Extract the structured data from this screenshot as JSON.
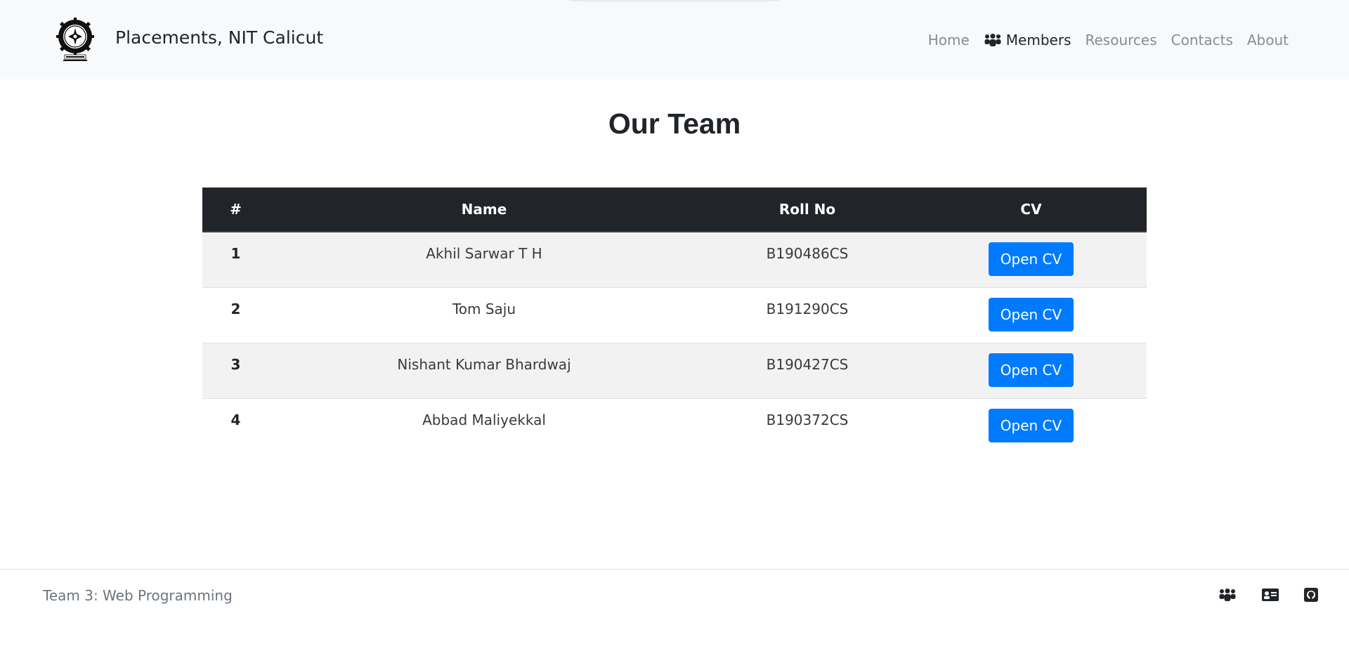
{
  "navbar": {
    "brand_name": "Placements, NIT Calicut",
    "logo_icon": "nitc-emblem-logo",
    "links": [
      {
        "label": "Home",
        "active": false
      },
      {
        "label": "Members",
        "active": true,
        "icon": "users-icon"
      },
      {
        "label": "Resources",
        "active": false
      },
      {
        "label": "Contacts",
        "active": false
      },
      {
        "label": "About",
        "active": false
      }
    ]
  },
  "main": {
    "title": "Our Team",
    "table": {
      "headers": [
        "#",
        "Name",
        "Roll No",
        "CV"
      ],
      "rows": [
        {
          "index": "1",
          "name": "Akhil Sarwar T H",
          "roll": "B190486CS",
          "cv_label": "Open CV"
        },
        {
          "index": "2",
          "name": "Tom Saju",
          "roll": "B191290CS",
          "cv_label": "Open CV"
        },
        {
          "index": "3",
          "name": "Nishant Kumar Bhardwaj",
          "roll": "B190427CS",
          "cv_label": "Open CV"
        },
        {
          "index": "4",
          "name": "Abbad Maliyekkal",
          "roll": "B190372CS",
          "cv_label": "Open CV"
        }
      ]
    }
  },
  "footer": {
    "text": "Team 3: Web Programming",
    "icons": [
      "users-icon",
      "id-card-icon",
      "github-icon"
    ]
  },
  "colors": {
    "navbar_bg": "#f8f9fa",
    "table_header_bg": "#212529",
    "button_primary": "#007bff",
    "stripe": "#f2f2f2",
    "muted_text": "#6c757d"
  }
}
